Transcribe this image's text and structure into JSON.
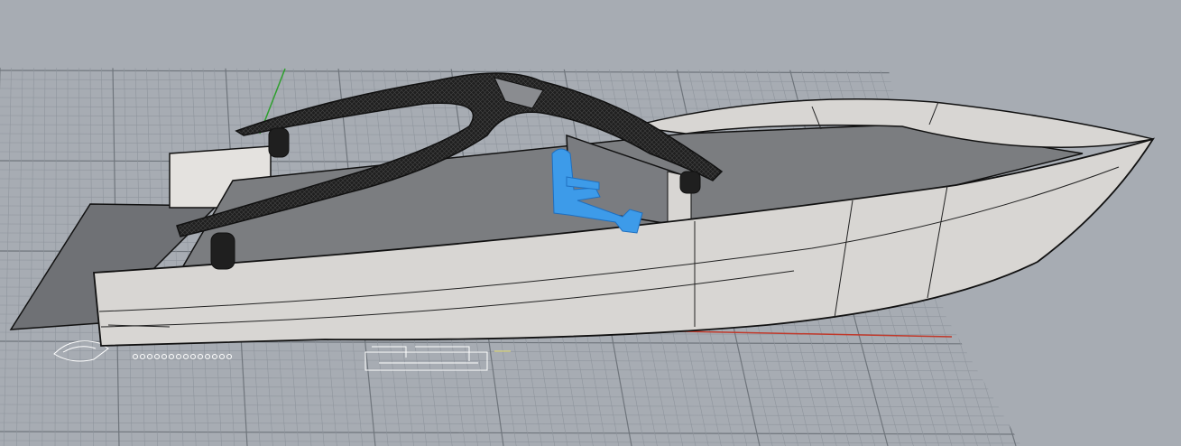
{
  "viewport": {
    "view_type": "perspective",
    "background_color": "#a7acb3",
    "grid_color": "#8f959d",
    "grid_major_color": "#6f757c",
    "x_axis_color": "#c0392b",
    "y_axis_color": "#2ea02e"
  },
  "model": {
    "hull_color": "#d8d6d3",
    "hull_shadow_color": "#b9b7b4",
    "deck_color": "#7b7d80",
    "platform_color": "#6f7175",
    "arch_color": "#1f1f1f",
    "figure_color": "#3d9be9",
    "edge_color": "#111111"
  },
  "icons": [
    "hull-model-icon",
    "arch-mesh-icon",
    "seated-figure-icon",
    "ground-drawing-icon"
  ]
}
